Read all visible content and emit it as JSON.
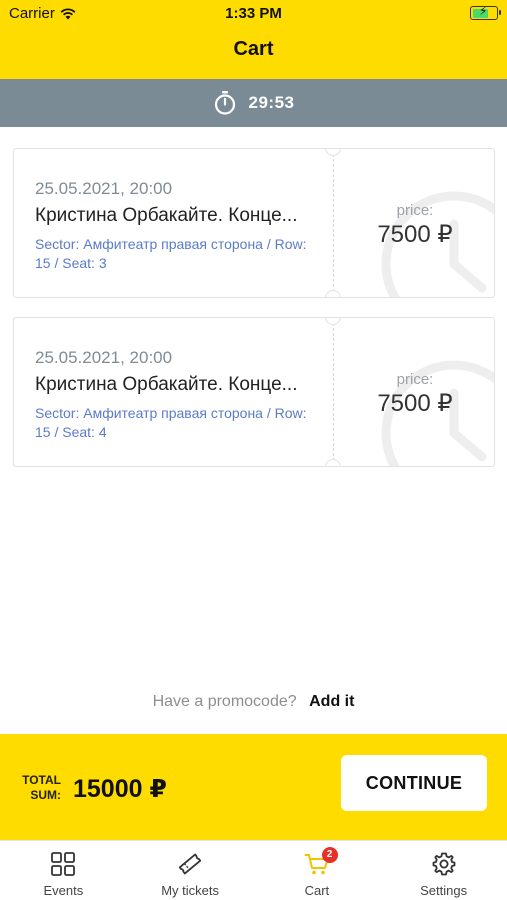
{
  "status_bar": {
    "carrier": "Carrier",
    "time": "1:33 PM"
  },
  "header": {
    "title": "Cart"
  },
  "timer": {
    "remaining": "29:53"
  },
  "tickets": [
    {
      "date": "25.05.2021, 20:00",
      "title": "Кристина Орбакайте. Конце...",
      "seat": "Sector: Амфитеатр правая сторона / Row: 15 / Seat: 3",
      "price_label": "price:",
      "price": "7500 ₽"
    },
    {
      "date": "25.05.2021, 20:00",
      "title": "Кристина Орбакайте. Конце...",
      "seat": "Sector: Амфитеатр правая сторона / Row: 15 / Seat: 4",
      "price_label": "price:",
      "price": "7500 ₽"
    }
  ],
  "promo": {
    "question": "Have a promocode?",
    "action": "Add it"
  },
  "footer": {
    "total_label": "TOTAL SUM:",
    "total_value": "15000 ₽",
    "continue_label": "CONTINUE"
  },
  "tabbar": {
    "items": [
      {
        "label": "Events",
        "icon": "events-grid-icon"
      },
      {
        "label": "My tickets",
        "icon": "ticket-icon"
      },
      {
        "label": "Cart",
        "icon": "cart-icon",
        "badge": "2",
        "active": true
      },
      {
        "label": "Settings",
        "icon": "gear-icon"
      }
    ]
  },
  "colors": {
    "accent": "#ffdc00",
    "timer_bar": "#7a8b95",
    "seat_text": "#5b7bc9",
    "badge": "#e63028"
  }
}
